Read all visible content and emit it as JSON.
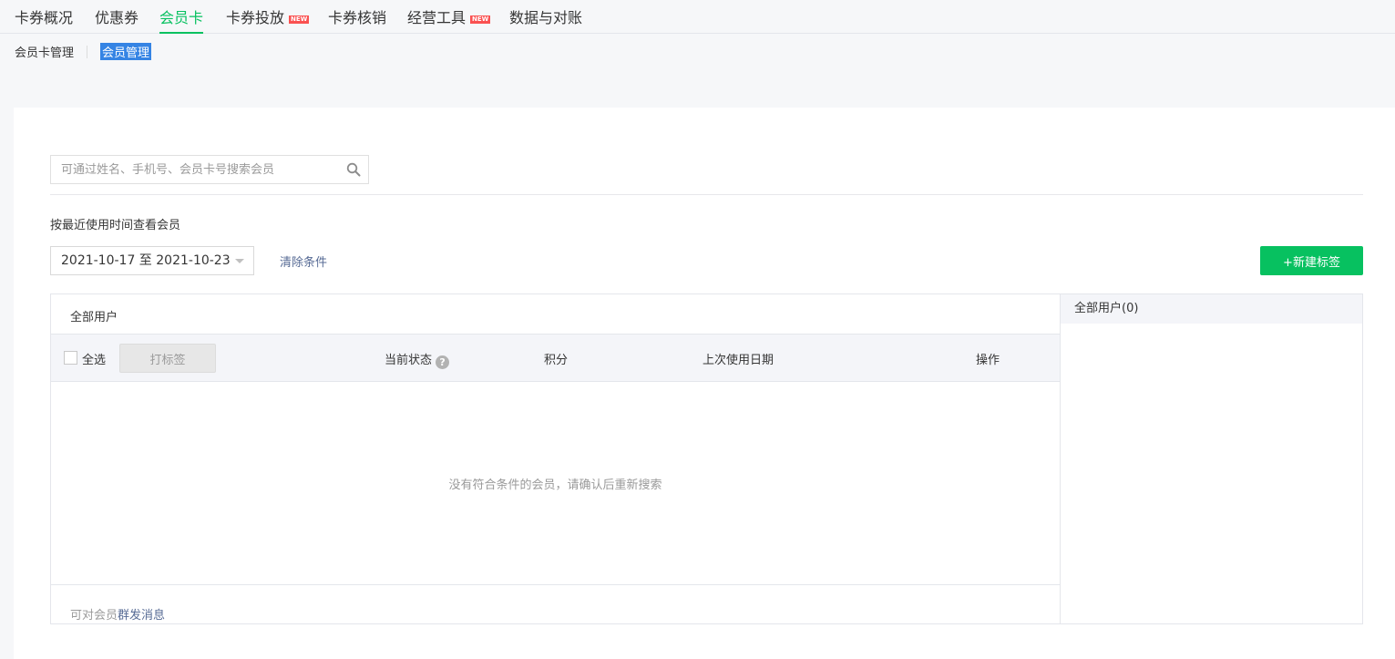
{
  "topnav": {
    "tabs": [
      {
        "label": "卡券概况"
      },
      {
        "label": "优惠券"
      },
      {
        "label": "会员卡"
      },
      {
        "label": "卡券投放",
        "badge": "NEW"
      },
      {
        "label": "卡券核销"
      },
      {
        "label": "经营工具",
        "badge": "NEW"
      },
      {
        "label": "数据与对账"
      }
    ],
    "active_tab": "会员卡"
  },
  "subnav": {
    "items": [
      {
        "label": "会员卡管理"
      },
      {
        "label": "会员管理"
      }
    ],
    "selected": "会员管理"
  },
  "search": {
    "placeholder": "可通过姓名、手机号、会员卡号搜索会员",
    "value": "",
    "icon": "search-icon"
  },
  "filter": {
    "label": "按最近使用时间查看会员",
    "date_range": "2021-10-17 至 2021-10-23",
    "clear_label": "清除条件"
  },
  "new_tag_button": "+新建标签",
  "table": {
    "title": "全部用户",
    "select_all_label": "全选",
    "tag_button_label": "打标签",
    "columns": [
      "当前状态",
      "积分",
      "上次使用日期",
      "操作"
    ],
    "help_icon": "question-circle-icon",
    "empty_text": "没有符合条件的会员，请确认后重新搜索"
  },
  "footer": {
    "prefix": "可对会员",
    "link": "群发消息"
  },
  "tag_panel": {
    "header": "全部用户(0)"
  },
  "colors": {
    "accent": "#07c160",
    "link": "#576b95",
    "badge": "#fa5151",
    "selection": "#3584e4"
  }
}
